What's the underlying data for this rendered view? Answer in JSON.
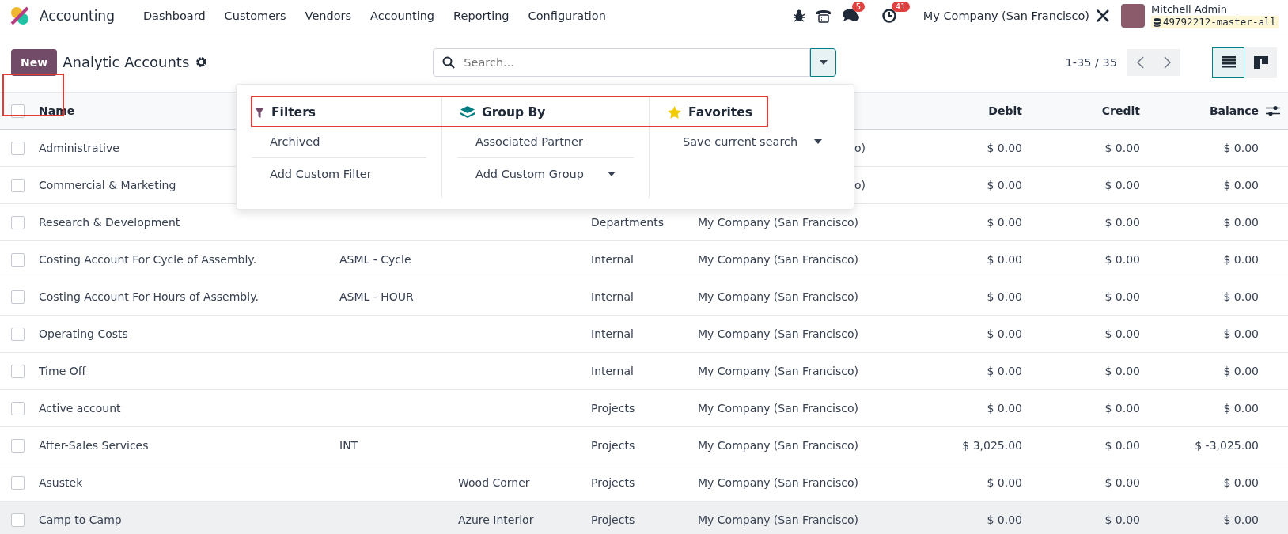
{
  "navbar": {
    "app_name": "Accounting",
    "menu": [
      "Dashboard",
      "Customers",
      "Vendors",
      "Accounting",
      "Reporting",
      "Configuration"
    ],
    "messages_badge": "5",
    "activities_badge": "41",
    "company": "My Company (San Francisco)",
    "user_name": "Mitchell Admin",
    "database": "49792212-master-all"
  },
  "control_panel": {
    "new_button": "New",
    "title": "Analytic Accounts",
    "search": {
      "placeholder": "Search..."
    },
    "pager": "1-35 / 35",
    "views": [
      {
        "kind": "list",
        "selected": true
      },
      {
        "kind": "kanban",
        "selected": false
      }
    ]
  },
  "search_dropdown": {
    "columns": [
      {
        "kind": "filter",
        "heading": "Filters",
        "items": [
          "Archived"
        ],
        "custom": "Add Custom Filter"
      },
      {
        "kind": "group",
        "heading": "Group By",
        "items": [
          "Associated Partner"
        ],
        "custom": "Add Custom Group"
      },
      {
        "kind": "favorite",
        "heading": "Favorites",
        "custom": "Save current search"
      }
    ]
  },
  "table": {
    "columns": [
      "Name",
      "Debit",
      "Credit",
      "Balance"
    ],
    "all_checked": false,
    "rows": [
      {
        "name": "Administrative",
        "company_tail": "o)",
        "debit": "$ 0.00",
        "credit": "$ 0.00",
        "balance": "$ 0.00",
        "hovered": false,
        "checked": false
      },
      {
        "name": "Commercial & Marketing",
        "company_tail": "o)",
        "debit": "$ 0.00",
        "credit": "$ 0.00",
        "balance": "$ 0.00",
        "hovered": false,
        "checked": false
      },
      {
        "name": "Research & Development",
        "plan": "Departments",
        "company": "My Company (San Francisco)",
        "debit": "$ 0.00",
        "credit": "$ 0.00",
        "balance": "$ 0.00",
        "hovered": false,
        "checked": false
      },
      {
        "name": "Costing Account For Cycle of Assembly.",
        "reference": "ASML - Cycle",
        "plan": "Internal",
        "company": "My Company (San Francisco)",
        "debit": "$ 0.00",
        "credit": "$ 0.00",
        "balance": "$ 0.00",
        "hovered": false,
        "checked": false
      },
      {
        "name": "Costing Account For Hours of Assembly.",
        "reference": "ASML - HOUR",
        "plan": "Internal",
        "company": "My Company (San Francisco)",
        "debit": "$ 0.00",
        "credit": "$ 0.00",
        "balance": "$ 0.00",
        "hovered": false,
        "checked": false
      },
      {
        "name": "Operating Costs",
        "plan": "Internal",
        "company": "My Company (San Francisco)",
        "debit": "$ 0.00",
        "credit": "$ 0.00",
        "balance": "$ 0.00",
        "hovered": false,
        "checked": false
      },
      {
        "name": "Time Off",
        "plan": "Internal",
        "company": "My Company (San Francisco)",
        "debit": "$ 0.00",
        "credit": "$ 0.00",
        "balance": "$ 0.00",
        "hovered": false,
        "checked": false
      },
      {
        "name": "Active account",
        "plan": "Projects",
        "company": "My Company (San Francisco)",
        "debit": "$ 0.00",
        "credit": "$ 0.00",
        "balance": "$ 0.00",
        "hovered": false,
        "checked": false
      },
      {
        "name": "After-Sales Services",
        "reference": "INT",
        "plan": "Projects",
        "company": "My Company (San Francisco)",
        "debit": "$ 3,025.00",
        "credit": "$ 0.00",
        "balance": "$ -3,025.00",
        "hovered": false,
        "checked": false
      },
      {
        "name": "Asustek",
        "partner": "Wood Corner",
        "plan": "Projects",
        "company": "My Company (San Francisco)",
        "debit": "$ 0.00",
        "credit": "$ 0.00",
        "balance": "$ 0.00",
        "hovered": false,
        "checked": false
      },
      {
        "name": "Camp to Camp",
        "partner": "Azure Interior",
        "plan": "Projects",
        "company": "My Company (San Francisco)",
        "debit": "$ 0.00",
        "credit": "$ 0.00",
        "balance": "$ 0.00",
        "hovered": true,
        "checked": false
      }
    ]
  }
}
